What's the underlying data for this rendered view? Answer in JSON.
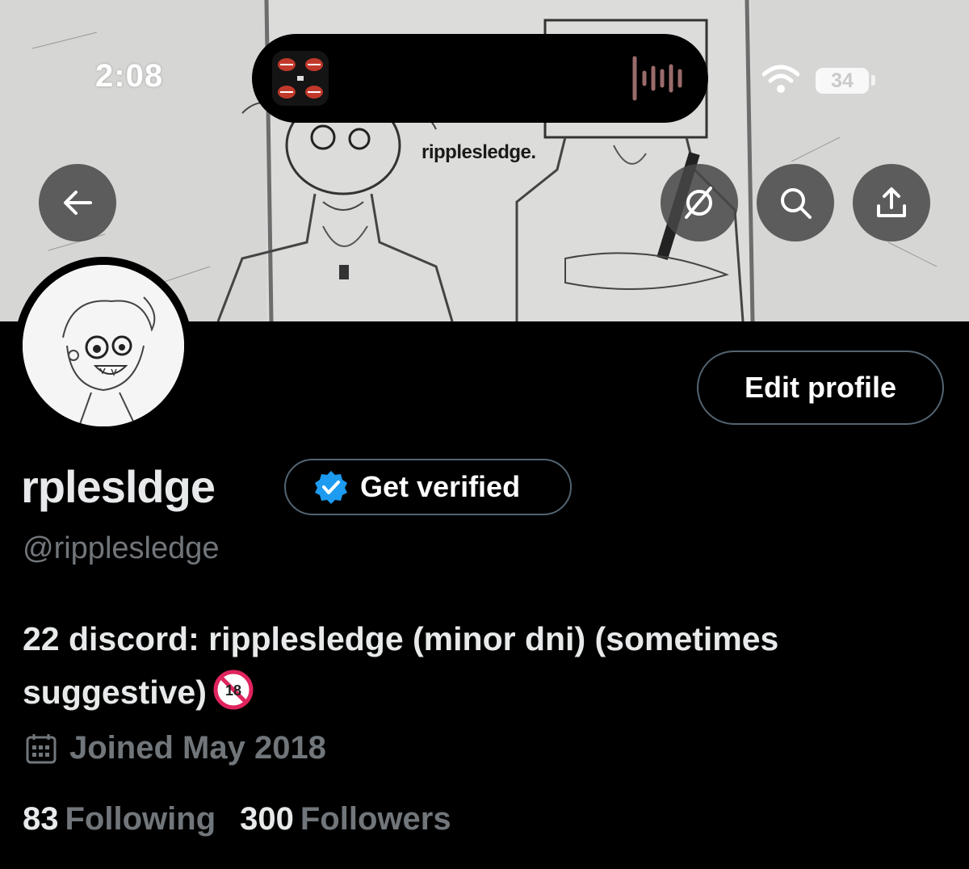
{
  "status_bar": {
    "time": "2:08",
    "battery": "34"
  },
  "banner": {
    "text": "ripplesledge."
  },
  "header_icons": [
    "back-arrow-icon",
    "grok-icon",
    "search-icon",
    "share-icon"
  ],
  "profile": {
    "display_name": "rplesldge",
    "verify_label": "Get verified",
    "handle": "@ripplesledge",
    "bio_line1": "22 discord: ripplesledge (minor dni) (sometimes",
    "bio_line2": "suggestive)",
    "joined": "Joined May 2018",
    "edit_label": "Edit profile",
    "following_count": "83",
    "following_label": "Following",
    "followers_count": "300",
    "followers_label": "Followers"
  },
  "colors": {
    "background": "#000000",
    "secondary_text": "#71767b",
    "verified_blue": "#1d9bf0",
    "border": "#536471"
  }
}
